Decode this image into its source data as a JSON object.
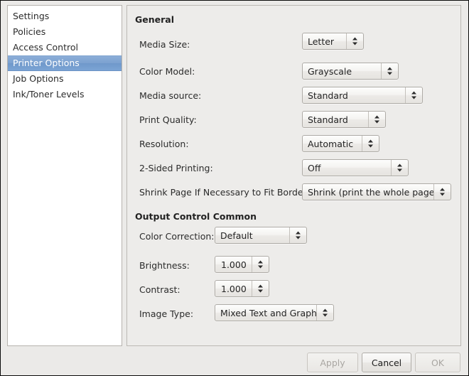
{
  "sidebar": {
    "items": [
      {
        "label": "Settings",
        "selected": false
      },
      {
        "label": "Policies",
        "selected": false
      },
      {
        "label": "Access Control",
        "selected": false
      },
      {
        "label": "Printer Options",
        "selected": true
      },
      {
        "label": "Job Options",
        "selected": false
      },
      {
        "label": "Ink/Toner Levels",
        "selected": false
      }
    ]
  },
  "panel": {
    "sections": [
      {
        "title": "General",
        "fields": [
          {
            "label": "Media Size:",
            "value": "Letter",
            "control": "combobox"
          },
          {
            "label": "Color Model:",
            "value": "Grayscale",
            "control": "combobox"
          },
          {
            "label": "Media source:",
            "value": "Standard",
            "control": "combobox"
          },
          {
            "label": "Print Quality:",
            "value": "Standard",
            "control": "combobox"
          },
          {
            "label": "Resolution:",
            "value": "Automatic",
            "control": "combobox"
          },
          {
            "label": "2-Sided Printing:",
            "value": "Off",
            "control": "combobox"
          },
          {
            "label": "Shrink Page If Necessary to Fit Borders:",
            "value": "Shrink (print the whole page)",
            "control": "combobox"
          }
        ]
      },
      {
        "title": "Output Control Common",
        "fields": [
          {
            "label": "Color Correction:",
            "value": "Default",
            "control": "combobox"
          },
          {
            "label": "Brightness:",
            "value": "1.000",
            "control": "spinbutton"
          },
          {
            "label": "Contrast:",
            "value": "1.000",
            "control": "spinbutton"
          },
          {
            "label": "Image Type:",
            "value": "Mixed Text and Graphics",
            "control": "combobox"
          }
        ]
      }
    ]
  },
  "footer": {
    "apply_label": "Apply",
    "cancel_label": "Cancel",
    "ok_label": "OK",
    "apply_enabled": false,
    "cancel_enabled": true,
    "ok_enabled": false
  },
  "colors": {
    "selection_blue": "#7ba1d0",
    "window_background": "#ebeae8",
    "panel_background": "#edecea",
    "sidebar_background": "#ffffff"
  }
}
